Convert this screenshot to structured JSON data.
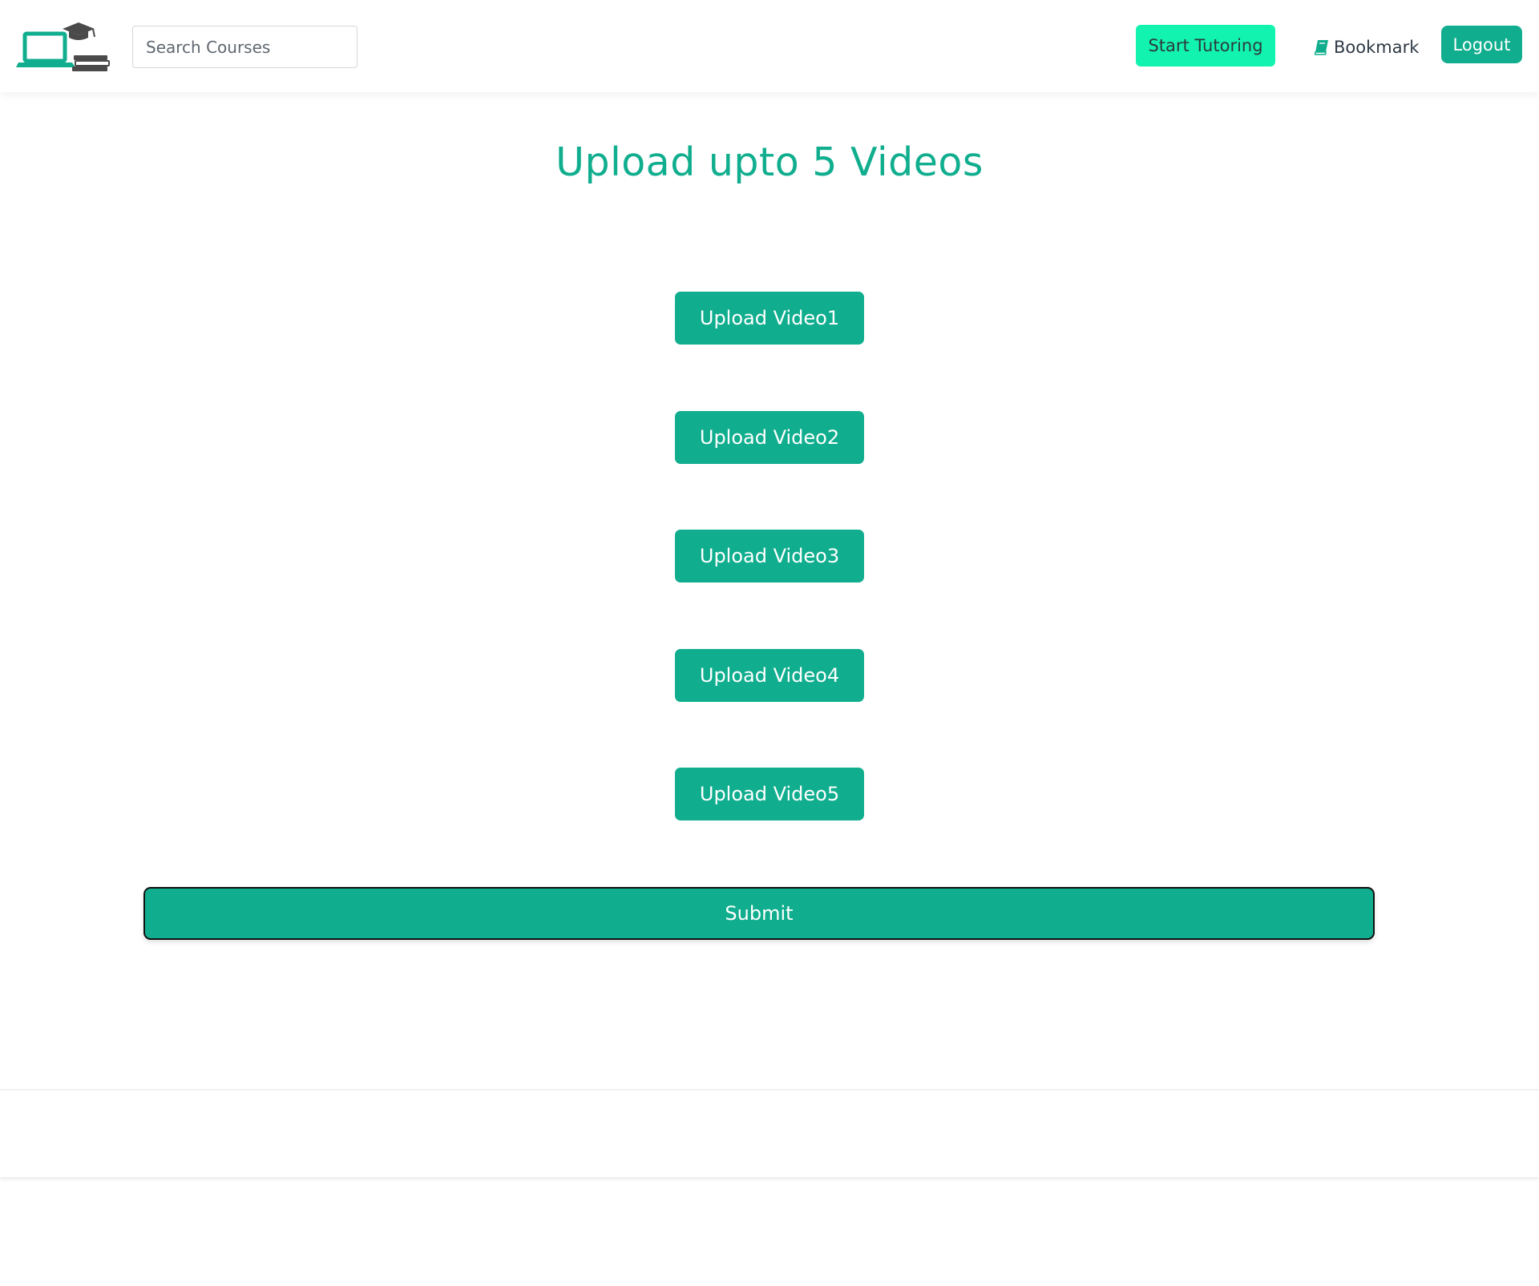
{
  "header": {
    "logo_icon": "laptop-graduation-cap-books-icon",
    "search": {
      "placeholder": "Search Courses",
      "value": ""
    },
    "start_tutoring_label": "Start Tutoring",
    "bookmark_label": "Bookmark",
    "bookmark_icon": "book-icon",
    "logout_label": "Logout"
  },
  "main": {
    "title": "Upload upto 5 Videos",
    "uploads": [
      {
        "label": "Upload Video1"
      },
      {
        "label": "Upload Video2"
      },
      {
        "label": "Upload Video3"
      },
      {
        "label": "Upload Video4"
      },
      {
        "label": "Upload Video5"
      }
    ],
    "submit_label": "Submit"
  },
  "colors": {
    "primary": "#10ae8e",
    "accent": "#13f3b0",
    "text_dark": "#2f3a46",
    "logo_dark": "#4a4a4a"
  }
}
